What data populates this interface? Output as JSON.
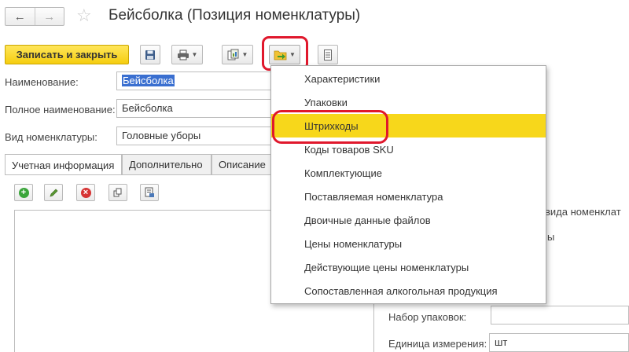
{
  "window": {
    "title": "Бейсболка (Позиция номенклатуры)"
  },
  "toolbar": {
    "save_close_label": "Записать и закрыть"
  },
  "form": {
    "name_label": "Наименование:",
    "name_value": "Бейсболка",
    "full_name_label": "Полное наименование:",
    "full_name_value": "Бейсболка",
    "kind_label": "Вид номенклатуры:",
    "kind_value": "Головные уборы"
  },
  "tabs": [
    "Учетная информация",
    "Дополнительно",
    "Описание"
  ],
  "right_panel": {
    "kind_note": "вида номенклат",
    "ending_fragment": "ы",
    "pack_set_label": "Набор упаковок:",
    "pack_set_value": "",
    "unit_label": "Единица измерения:",
    "unit_value": "шт"
  },
  "menu": {
    "items": [
      "Характеристики",
      "Упаковки",
      "Штрихкоды",
      "Коды товаров SKU",
      "Комплектующие",
      "Поставляемая номенклатура",
      "Двоичные данные файлов",
      "Цены номенклатуры",
      "Действующие цены номенклатуры",
      "Сопоставленная алкогольная продукция"
    ],
    "highlighted_item": "Штрихкоды"
  },
  "colors": {
    "primary_button": "#f5cd0f",
    "menu_highlight": "#f7d71b",
    "annotation_red": "#e0182c",
    "selection_blue": "#3a6fd0"
  }
}
